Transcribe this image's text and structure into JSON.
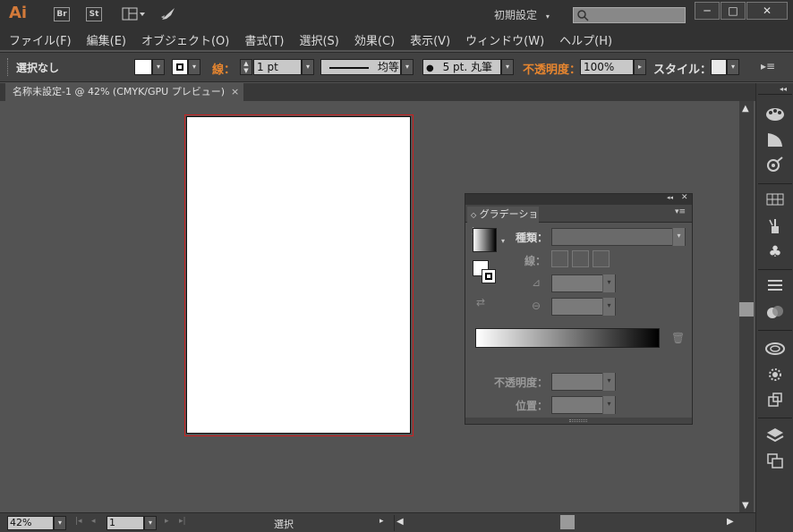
{
  "app": {
    "logo": "Ai",
    "bridge_label": "Br",
    "stock_label": "St"
  },
  "workspace": {
    "label": "初期設定"
  },
  "window_controls": {
    "minimize": "─",
    "maximize": "□",
    "close": "✕"
  },
  "menu": [
    "ファイル(F)",
    "編集(E)",
    "オブジェクト(O)",
    "書式(T)",
    "選択(S)",
    "効果(C)",
    "表示(V)",
    "ウィンドウ(W)",
    "ヘルプ(H)"
  ],
  "control": {
    "selection": "選択なし",
    "stroke_label": "線：",
    "stroke_weight": "1 pt",
    "stroke_profile": "均等",
    "brush": "5 pt. 丸筆",
    "opacity_label": "不透明度：",
    "opacity_value": "100%",
    "style_label": "スタイル："
  },
  "document_tab": {
    "title": "名称未設定-1 @ 42% (CMYK/GPU プレビュー)",
    "close": "×"
  },
  "gradient_panel": {
    "tab_label": "グラデーション",
    "type_label": "種類：",
    "stroke_label": "線：",
    "opacity_label": "不透明度：",
    "location_label": "位置：",
    "collapse": "◂◂",
    "close": "✕"
  },
  "status": {
    "zoom": "42%",
    "artboard": "1",
    "tool_label": "選択"
  },
  "colors": {
    "accent": "#e8862f",
    "artboard_border": "#d02020"
  },
  "icons": {
    "right_panel": [
      "palette-icon",
      "color-guide-icon",
      "appearance-icon",
      "swatches-icon",
      "brushes-icon",
      "symbols-icon",
      "stroke-icon",
      "transparency-icon",
      "libraries-icon",
      "graphic-styles-icon",
      "export-icon",
      "layers-icon",
      "artboards-icon"
    ]
  }
}
